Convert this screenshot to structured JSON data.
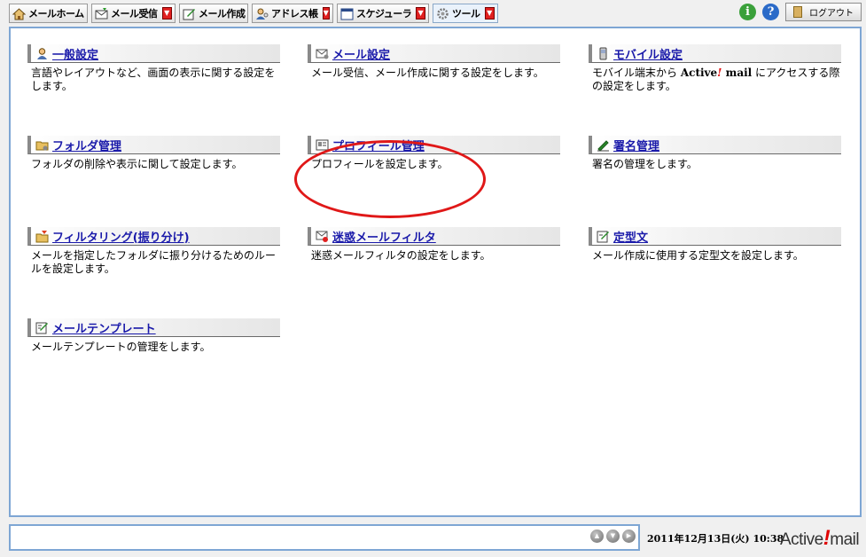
{
  "toolbar": {
    "tabs": [
      {
        "label": "メールホーム",
        "icon": "home-icon",
        "dropdown": false
      },
      {
        "label": "メール受信",
        "icon": "inbox-icon",
        "dropdown": true
      },
      {
        "label": "メール作成",
        "icon": "compose-icon",
        "dropdown": false
      },
      {
        "label": "アドレス帳",
        "icon": "address-book-icon",
        "dropdown": true
      },
      {
        "label": "スケジューラ",
        "icon": "calendar-icon",
        "dropdown": true
      },
      {
        "label": "ツール",
        "icon": "gear-icon",
        "dropdown": true,
        "active": true
      }
    ],
    "info_glyph": "i",
    "help_glyph": "?",
    "logout_label": "ログアウト"
  },
  "items": [
    {
      "title": "一般設定",
      "icon": "user-icon",
      "desc": "言語やレイアウトなど、画面の表示に関する設定をします。"
    },
    {
      "title": "メール設定",
      "icon": "mail-icon",
      "desc": "メール受信、メール作成に関する設定をします。"
    },
    {
      "title": "モバイル設定",
      "icon": "mobile-phone-icon",
      "desc_pre": "モバイル端末から ",
      "desc_brand_a": "Active",
      "desc_brand_b": "!",
      "desc_brand_c": " mail",
      "desc_post": " にアクセスする際の設定をします。"
    },
    {
      "title": "フォルダ管理",
      "icon": "folder-icon",
      "desc": "フォルダの削除や表示に関して設定します。"
    },
    {
      "title": "プロフィール管理",
      "icon": "profile-card-icon",
      "desc": "プロフィールを設定します。"
    },
    {
      "title": "署名管理",
      "icon": "pen-icon",
      "desc": "署名の管理をします。"
    },
    {
      "title": "フィルタリング(振り分け)",
      "icon": "filter-folder-icon",
      "desc": "メールを指定したフォルダに振り分けるためのルールを設定します。"
    },
    {
      "title": "迷惑メールフィルタ",
      "icon": "spam-mail-icon",
      "desc": "迷惑メールフィルタの設定をします。"
    },
    {
      "title": "定型文",
      "icon": "template-text-icon",
      "desc": "メール作成に使用する定型文を設定します。"
    },
    {
      "title": "メールテンプレート",
      "icon": "mail-template-icon",
      "desc": "メールテンプレートの管理をします。"
    }
  ],
  "status": {
    "datetime": "2011年12月13日(火) 10:38",
    "brand_a": "Active",
    "brand_b": "!",
    "brand_c": "mail",
    "nav": [
      "up",
      "down",
      "right"
    ]
  },
  "colors": {
    "panel_border": "#7ea6d4",
    "link": "#1a1aaa",
    "dropdown": "#e02020",
    "highlight_circle": "#e01818"
  }
}
